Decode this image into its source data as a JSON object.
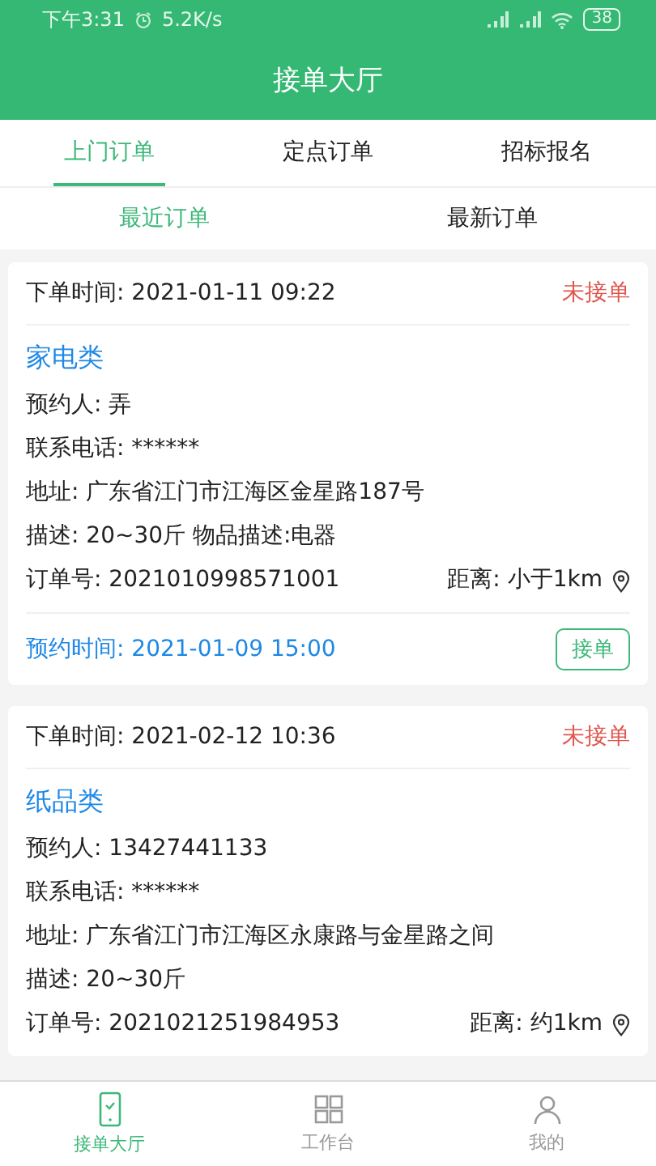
{
  "status_bar": {
    "time": "下午3:31",
    "speed": "5.2K/s",
    "battery": "38"
  },
  "header": {
    "title": "接单大厅"
  },
  "tabs": [
    {
      "label": "上门订单",
      "selected": true
    },
    {
      "label": "定点订单",
      "selected": false
    },
    {
      "label": "招标报名",
      "selected": false
    }
  ],
  "sub_tabs": [
    {
      "label": "最近订单",
      "selected": true
    },
    {
      "label": "最新订单",
      "selected": false
    }
  ],
  "orders": [
    {
      "order_time": "下单时间: 2021-01-11 09:22",
      "status": "未接单",
      "category": "家电类",
      "contact": "预约人: 弄",
      "phone": "联系电话: ******",
      "address": "地址: 广东省江门市江海区金星路187号",
      "description": "描述: 20~30斤 物品描述:电器",
      "order_no": "订单号: 2021010998571001",
      "distance": "距离: 小于1km",
      "booking_time": "预约时间: 2021-01-09 15:00",
      "action": "接单"
    },
    {
      "order_time": "下单时间: 2021-02-12 10:36",
      "status": "未接单",
      "category": "纸品类",
      "contact": "预约人: 13427441133",
      "phone": "联系电话: ******",
      "address": "地址: 广东省江门市江海区永康路与金星路之间",
      "description": "描述: 20~30斤",
      "order_no": "订单号: 2021021251984953",
      "distance": "距离: 约1km"
    }
  ],
  "bottom_nav": [
    {
      "label": "接单大厅",
      "selected": true
    },
    {
      "label": "工作台",
      "selected": false
    },
    {
      "label": "我的",
      "selected": false
    }
  ]
}
